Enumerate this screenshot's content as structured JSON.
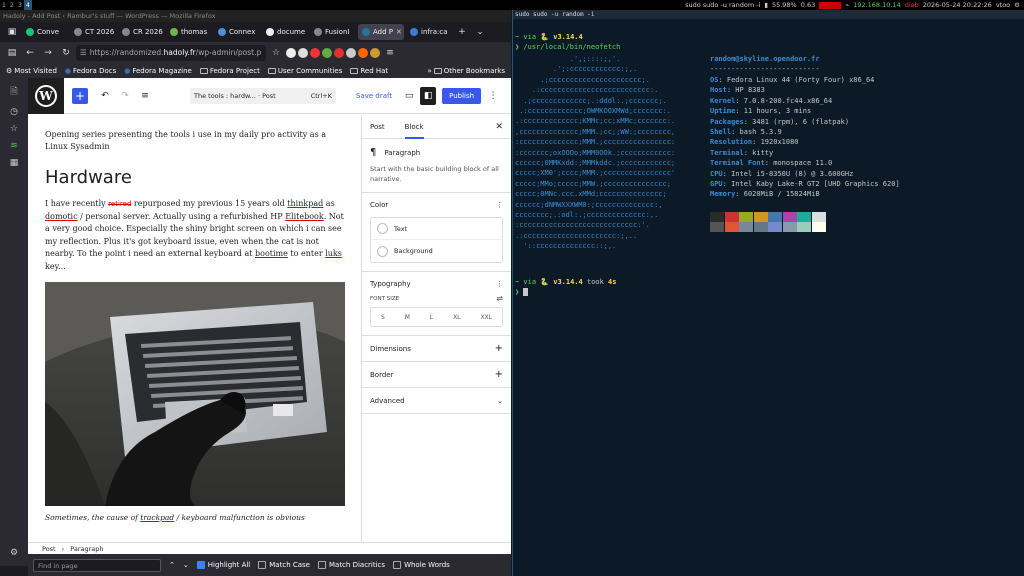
{
  "topbar": {
    "workspaces": [
      "1",
      "2",
      "3",
      "4"
    ],
    "active_workspace": "4",
    "window_title": "sudo sudo -u random -i",
    "battery": "55.98%",
    "load": "0.63",
    "ip": "192.168.10.14",
    "alert": "diab",
    "datetime": "2026-05-24 20:22:26",
    "vpn": "vtoo"
  },
  "firefox": {
    "title": "Hadoly - Add Post ‹ Rambur's stuff — WordPress — Mozilla Firefox",
    "tabs": [
      {
        "label": "Conve",
        "color": "#19c37d"
      },
      {
        "label": "CT 2026",
        "color": "#888888"
      },
      {
        "label": "CR 2026",
        "color": "#888888"
      },
      {
        "label": "thomas",
        "color": "#6fb54a"
      },
      {
        "label": "Connex",
        "color": "#4a90d9"
      },
      {
        "label": "docume",
        "color": "#eeeeee"
      },
      {
        "label": "FusionI",
        "color": "#888888"
      },
      {
        "label": "Add P",
        "color": "#21759b"
      },
      {
        "label": "infra:ca",
        "color": "#3a7bd5"
      }
    ],
    "active_tab": 7,
    "url_prefix": "https://randomized.",
    "url_domain": "hadoly.fr",
    "url_rest": "/wp-admin/post.p",
    "bookmarks": [
      "Most Visited",
      "Fedora Docs",
      "Fedora Magazine",
      "Fedora Project",
      "User Communities",
      "Red Hat"
    ],
    "other_bookmarks": "Other Bookmarks"
  },
  "editor": {
    "doc_title": "The tools : hardw...",
    "doc_type": "· Post",
    "shortcut": "Ctrl+K",
    "save_draft": "Save draft",
    "publish": "Publish",
    "intro": "Opening series presenting the tools i use in my daily pro activity as a Linux Sysadmin",
    "heading": "Hardware",
    "para": {
      "p1": "I have recently ",
      "strike": "retired",
      "p2": "  repurposed my previous 15 years old ",
      "w_thinkpad": "thinkpad",
      "p3": " as ",
      "w_domotic": "domotic",
      "p4": " / personal server. Actually using a refurbished HP ",
      "w_elitebook": "Elitebook",
      "p5": ". Not a very good choice. Especially the shiny bright screen  on which i can see my reflection. Plus it's got keyboard issue, even when the cat is not nearby. To the point i need an external keyboard at ",
      "w_bootime": "bootime",
      "p6": " to enter ",
      "w_luks": "luks",
      "p7": " key..."
    },
    "caption_pre": "Sometimes, the cause of ",
    "caption_word": "trackpad",
    "caption_post": " / keyboard malfunction is obvious",
    "breadcrumb": [
      "Post",
      "Paragraph"
    ]
  },
  "inspector": {
    "tabs": [
      "Post",
      "Block"
    ],
    "block_name": "Paragraph",
    "block_desc": "Start with the basic building block of all narrative.",
    "color_title": "Color",
    "color_items": [
      "Text",
      "Background"
    ],
    "typography_title": "Typography",
    "font_size_label": "FONT SIZE",
    "sizes": [
      "S",
      "M",
      "L",
      "XL",
      "XXL"
    ],
    "dimensions": "Dimensions",
    "border": "Border",
    "advanced": "Advanced"
  },
  "findbar": {
    "placeholder": "Find in page",
    "highlight_all": "Highlight All",
    "match_case": "Match Case",
    "match_diacritics": "Match Diacritics",
    "whole_words": "Whole Words"
  },
  "terminal": {
    "title": "sudo sudo -u random -i",
    "prompt_via": "~ via ",
    "python": "🐍 v3.14.4",
    "command": "❯ /usr/local/bin/neofetch",
    "userhost": "random@skyline.opendoor.fr",
    "separator": "--------------------------",
    "info": [
      {
        "k": "OS",
        "v": "Fedora Linux 44 (Forty Four) x86_64"
      },
      {
        "k": "Host",
        "v": "HP 8383"
      },
      {
        "k": "Kernel",
        "v": "7.0.8-200.fc44.x86_64"
      },
      {
        "k": "Uptime",
        "v": "11 hours, 3 mins"
      },
      {
        "k": "Packages",
        "v": "3481 (rpm), 6 (flatpak)"
      },
      {
        "k": "Shell",
        "v": "bash 5.3.9"
      },
      {
        "k": "Resolution",
        "v": "1920x1080"
      },
      {
        "k": "Terminal",
        "v": "kitty"
      },
      {
        "k": "Terminal Font",
        "v": "monospace 11.0"
      },
      {
        "k": "CPU",
        "v": "Intel i5-8350U (8) @ 3.600GHz"
      },
      {
        "k": "GPU",
        "v": "Intel Kaby Lake-R GT2 [UHD Graphics 620]"
      },
      {
        "k": "Memory",
        "v": "6020MiB / 15824MiB"
      }
    ],
    "logo": [
      "             .',;::::;,'.",
      "         .';:cccccccccccc:;,.",
      "      .;cccccccccccccccccccccc;.",
      "    .:cccccccccccccccccccccccccc:.",
      "  .;ccccccccccccc;.:dddl:.;ccccccc;.",
      " .:ccccccccccccc;OWMKOOXMWd;ccccccc:.",
      ".:ccccccccccccc;KMMc;cc;xMMc;ccccccc:.",
      ",cccccccccccccc;MMM.;cc;;WW:;cccccccc,",
      ":cccccccccccccc;MMM.;cccccccccccccccc:",
      ":ccccccc;oxOOOo;MMM0OOk.;cccccccccccc:",
      "cccccc;0MMKxdd:;MMMkddc.;cccccccccccc;",
      "ccccc;XM0';cccc;MMM.;cccccccccccccccc'",
      "ccccc;MMo;ccccc;MMW.;ccccccccccccccc;",
      "ccccc;0MNc.ccc.xMMd;ccccccccccccccc;",
      "cccccc;dNMWXXXWM0:;cccccccccccccc:,",
      "cccccccc;.:odl:.;cccccccccccccc:,.",
      ":cccccccccccccccccccccccccccc:'.",
      ".:cccccccccccccccccccccc:;,..",
      "  '::cccccccccccccc::;,."
    ],
    "palette_top": [
      "#2b2b2b",
      "#cc3333",
      "#99aa22",
      "#cc9922",
      "#4477aa",
      "#aa44aa",
      "#22aa99",
      "#dddddd"
    ],
    "palette_bottom": [
      "#555555",
      "#e05533",
      "#778899",
      "#667788",
      "#7788cc",
      "#8899aa",
      "#99ccbb",
      "#fffff0"
    ],
    "took_label": " took ",
    "took": "4s",
    "prompt_char": "❯"
  }
}
